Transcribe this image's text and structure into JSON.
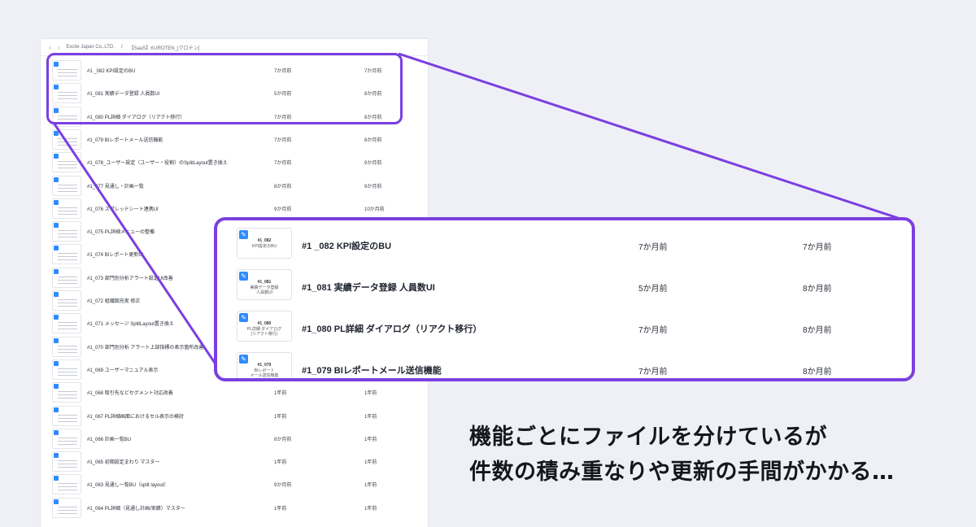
{
  "breadcrumb": {
    "org": "Excite Japan Co.,LTD.",
    "project": "【SaaS】KUROTEN_[クロテン]"
  },
  "files": [
    {
      "name": "#1 _082 KPI設定のBU",
      "edited": "7か月前",
      "created": "7か月前",
      "thumb": [
        "#1_082",
        "KPI設定のBU"
      ]
    },
    {
      "name": "#1_081 実績データ登録 人員数UI",
      "edited": "5か月前",
      "created": "8か月前",
      "thumb": [
        "#1_081",
        "実績データ登録",
        "人員数UI"
      ]
    },
    {
      "name": "#1_080 PL詳細 ダイアログ（リアクト移行）",
      "edited": "7か月前",
      "created": "8か月前",
      "thumb": [
        "#1_080",
        "PL詳細 ダイアログ",
        "(リアクト移行)"
      ]
    },
    {
      "name": "#1_079 BIレポートメール送信機能",
      "edited": "7か月前",
      "created": "8か月前",
      "thumb": [
        "#1_079",
        "BIレポート",
        "メール送信機能"
      ]
    },
    {
      "name": "#1_078_ユーザー設定（ユーザー・役割）のSplitLayout置き換え",
      "edited": "7か月前",
      "created": "9か月前"
    },
    {
      "name": "#1_077 見通し・計画一覧",
      "edited": "8か月前",
      "created": "9か月前"
    },
    {
      "name": "#1_076 スプレッドシート連携UI",
      "edited": "9か月前",
      "created": "10か月前"
    },
    {
      "name": "#1_075 PL詳細メニューの整備",
      "edited": "",
      "created": ""
    },
    {
      "name": "#1_074 BIレポート更新UI",
      "edited": "",
      "created": ""
    },
    {
      "name": "#1_073 部門別分析アラート設定UI改善",
      "edited": "",
      "created": ""
    },
    {
      "name": "#1_072 組織図充実 修正",
      "edited": "",
      "created": ""
    },
    {
      "name": "#1_071 メッセージ SplitLayout置き換え",
      "edited": "",
      "created": ""
    },
    {
      "name": "#1_070 部門別分析 アラート上部指標の表示箇所改善",
      "edited": "",
      "created": ""
    },
    {
      "name": "#1_069 ユーザーマニュアル表示",
      "edited": "",
      "created": ""
    },
    {
      "name": "#1_068 取引先などセグメント対応改善",
      "edited": "1年前",
      "created": "1年前"
    },
    {
      "name": "#1_067 PL詳細画面におけるセル表示の検討",
      "edited": "1年前",
      "created": "1年前"
    },
    {
      "name": "#1_066 計画一覧BU",
      "edited": "8か月前",
      "created": "1年前"
    },
    {
      "name": "#1_065 初期設定まわり マスター",
      "edited": "1年前",
      "created": "1年前"
    },
    {
      "name": "#1_063 見通し一覧BU（split layout）",
      "edited": "9か月前",
      "created": "1年前"
    },
    {
      "name": "#1_064 PL詳細（見通し計画/実績）マスター",
      "edited": "1年前",
      "created": "1年前"
    }
  ],
  "caption": {
    "line1": "機能ごとにファイルを分けているが",
    "line2": "件数の積み重なりや更新の手間がかかる…"
  },
  "colors": {
    "highlight": "#7b3fe0",
    "figma_badge": "#2f8bff",
    "background": "#eef0f6"
  },
  "icons": {
    "back": "chevron-left-icon",
    "forward": "chevron-right-icon",
    "file_badge": "figma-file-icon"
  }
}
